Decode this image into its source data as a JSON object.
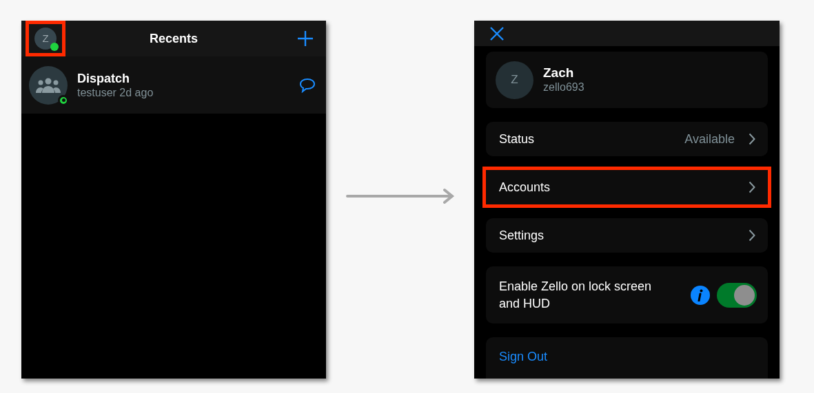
{
  "recents_screen": {
    "header": {
      "avatar_initial": "Z",
      "online": true,
      "highlighted": true,
      "title": "Recents"
    },
    "items": [
      {
        "name": "Dispatch",
        "subtitle": "testuser 2d ago",
        "online": true
      }
    ]
  },
  "menu_screen": {
    "profile": {
      "initial": "Z",
      "name": "Zach",
      "username": "zello693"
    },
    "items": [
      {
        "kind": "nav",
        "label": "Status",
        "value": "Available",
        "highlighted": false
      },
      {
        "kind": "nav",
        "label": "Accounts",
        "highlighted": true
      },
      {
        "kind": "nav",
        "label": "Settings",
        "highlighted": false
      },
      {
        "kind": "toggle",
        "label": "Enable Zello on lock screen and HUD",
        "on": true
      },
      {
        "kind": "link",
        "label": "Sign Out"
      }
    ]
  }
}
